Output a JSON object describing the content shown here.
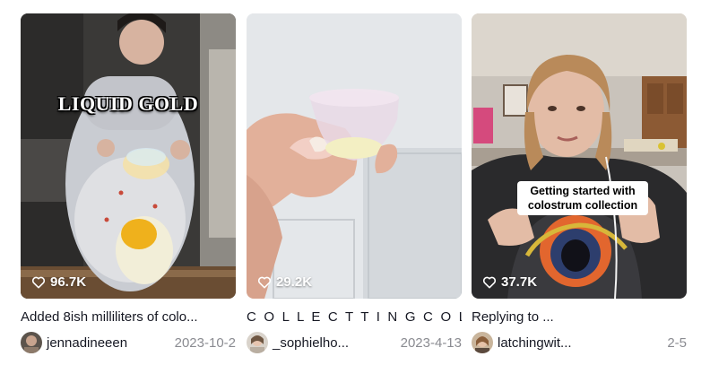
{
  "videos": [
    {
      "overlay_text": "LIQUID GOLD",
      "likes": "96.7K",
      "description": "Added 8ish milliliters of colo...",
      "username": "jennadineeen",
      "date": "2023-10-2"
    },
    {
      "overlay_text": "",
      "likes": "29.2K",
      "description": "C O L L E C T T I N G C O L O...",
      "username": "_sophielho...",
      "date": "2023-4-13"
    },
    {
      "overlay_text": "Getting started with colostrum collection",
      "likes": "37.7K",
      "description": "Replying to ...",
      "username": "latchingwit...",
      "date": "2-5"
    }
  ],
  "icons": {
    "likes": "heart-outline-icon"
  },
  "colors": {
    "date_text": "#8a8b91",
    "text": "#161823",
    "likes_text": "#ffffff"
  }
}
